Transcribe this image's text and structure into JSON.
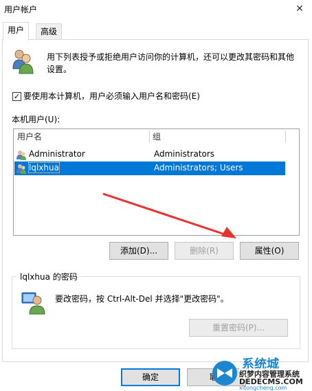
{
  "window": {
    "title": "用户帐户",
    "close_glyph": "✕"
  },
  "tabs": [
    {
      "label": "用户",
      "active": true
    },
    {
      "label": "高级",
      "active": false
    }
  ],
  "description": "用下列表授予或拒绝用户访问你的计算机，还可以更改其密码和其他设置。",
  "require_login": {
    "checked": true,
    "check_glyph": "✓",
    "label": "要使用本计算机，用户必须输入用户名和密码(E)"
  },
  "local_users": {
    "label": "本机用户(U):",
    "columns": {
      "username": "用户名",
      "group": "组"
    },
    "rows": [
      {
        "username": "Administrator",
        "group": "Administrators",
        "selected": false
      },
      {
        "username": "lqlxhua",
        "group": "Administrators; Users",
        "selected": true
      }
    ],
    "scroll_up_glyph": "▲"
  },
  "buttons": {
    "add": "添加(D)...",
    "remove": "删除(R)",
    "properties": "属性(O)"
  },
  "password_group": {
    "title": "lqlxhua 的密码",
    "text": "要改密码，按 Ctrl-Alt-Del 并选择\"更改密码\"。",
    "reset_button": "重置密码(P)..."
  },
  "footer": {
    "ok": "确定",
    "cancel": "取"
  },
  "watermark": {
    "brand": "系统城",
    "line1": "织梦内容管理系统",
    "line2": "DEDECMS.COM",
    "line3": "xitongcheng.com"
  },
  "colors": {
    "selection": "#0078d7",
    "arrow": "#e8322c",
    "accent": "#0078d7"
  }
}
